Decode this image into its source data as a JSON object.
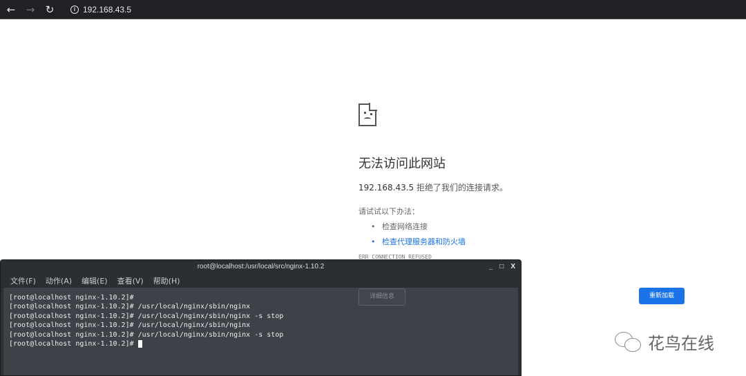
{
  "browser": {
    "url": "192.168.43.5"
  },
  "error": {
    "title": "无法访问此网站",
    "host": "192.168.43.5",
    "message": " 拒绝了我们的连接请求。",
    "try_label": "请试试以下办法：",
    "suggestions": [
      "检查网络连接",
      "检查代理服务器和防火墙"
    ],
    "code": "ERR_CONNECTION_REFUSED",
    "details_label": "详细信息",
    "reload_label": "重新加载"
  },
  "terminal": {
    "title": "root@localhost:/usr/local/src/nginx-1.10.2",
    "menu": [
      "文件(F)",
      "动作(A)",
      "编辑(E)",
      "查看(V)",
      "帮助(H)"
    ],
    "lines": [
      "[root@localhost nginx-1.10.2]#",
      "[root@localhost nginx-1.10.2]# /usr/local/nginx/sbin/nginx",
      "[root@localhost nginx-1.10.2]# /usr/local/nginx/sbin/nginx -s stop",
      "[root@localhost nginx-1.10.2]# /usr/local/nginx/sbin/nginx",
      "[root@localhost nginx-1.10.2]# /usr/local/nginx/sbin/nginx -s stop",
      "[root@localhost nginx-1.10.2]# "
    ]
  },
  "watermark": {
    "text": "花鸟在线"
  },
  "colors": {
    "accent": "#1a73e8",
    "terminal_bg": "#3e4148"
  }
}
